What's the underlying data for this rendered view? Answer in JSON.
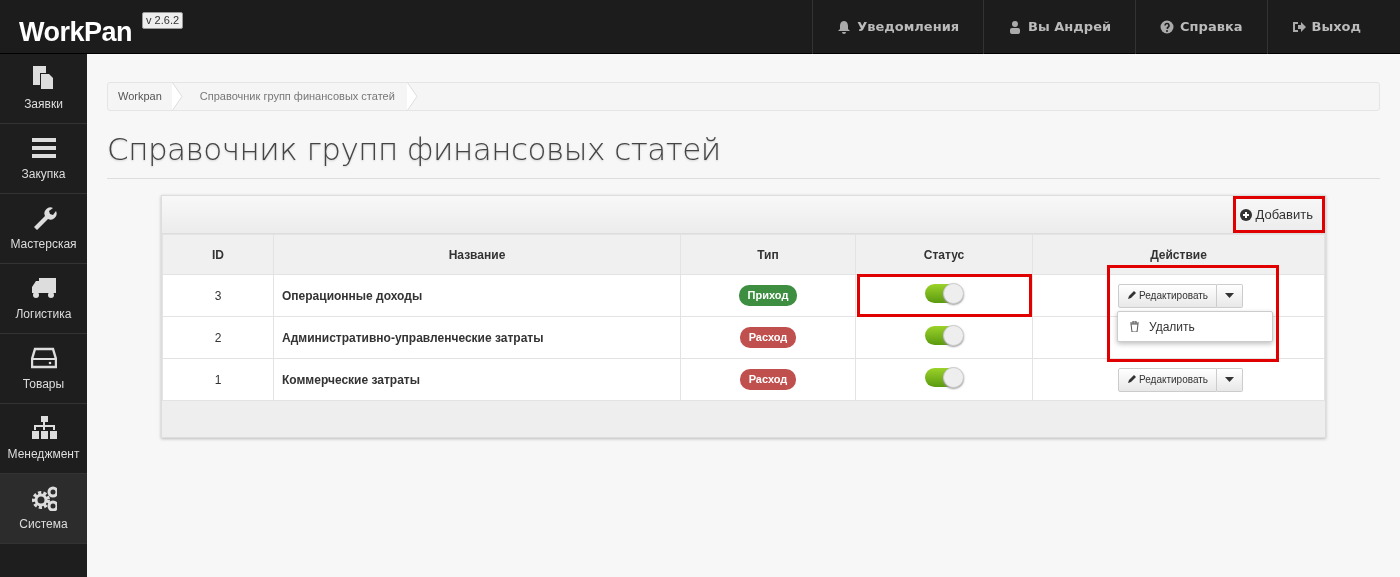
{
  "brand": {
    "name": "WorkPan",
    "version": "v 2.6.2"
  },
  "top_menu": [
    {
      "kind": "bell",
      "label": "Уведомления"
    },
    {
      "kind": "user",
      "label": "Вы Андрей"
    },
    {
      "kind": "help",
      "label": "Справка"
    },
    {
      "kind": "exit",
      "label": "Выход"
    }
  ],
  "sidebar": {
    "items": [
      {
        "kind": "docs",
        "label": "Заявки",
        "selected": false
      },
      {
        "kind": "bars",
        "label": "Закупка",
        "selected": false
      },
      {
        "kind": "wrench",
        "label": "Мастерская",
        "selected": false
      },
      {
        "kind": "truck",
        "label": "Логистика",
        "selected": false
      },
      {
        "kind": "drive",
        "label": "Товары",
        "selected": false
      },
      {
        "kind": "tree",
        "label": "Менеджмент",
        "selected": false
      },
      {
        "kind": "gears",
        "label": "Система",
        "selected": true
      }
    ]
  },
  "breadcrumb": [
    "Workpan",
    "Справочник групп финансовых статей"
  ],
  "page_title": "Справочник групп финансовых статей",
  "add_button": {
    "label": "Добавить",
    "highlighted": true
  },
  "table": {
    "columns": [
      "ID",
      "Название",
      "Тип",
      "Статус",
      "Действие"
    ],
    "rows": [
      {
        "id": "3",
        "name": "Операционные доходы",
        "type": {
          "label": "Приход",
          "kind": "income"
        },
        "status": {
          "on": true,
          "highlighted": true
        },
        "edit_button": "Редактировать",
        "action_highlighted": true,
        "menu": [
          {
            "label": "Удалить"
          }
        ]
      },
      {
        "id": "2",
        "name": "Административно-управленческие затраты",
        "type": {
          "label": "Расход",
          "kind": "expense"
        },
        "status": {
          "on": true,
          "highlighted": false
        },
        "action_highlighted": false
      },
      {
        "id": "1",
        "name": "Коммерческие затраты",
        "type": {
          "label": "Расход",
          "kind": "expense"
        },
        "status": {
          "on": true,
          "highlighted": false
        },
        "edit_button": "Редактировать",
        "action_highlighted": false
      }
    ]
  }
}
